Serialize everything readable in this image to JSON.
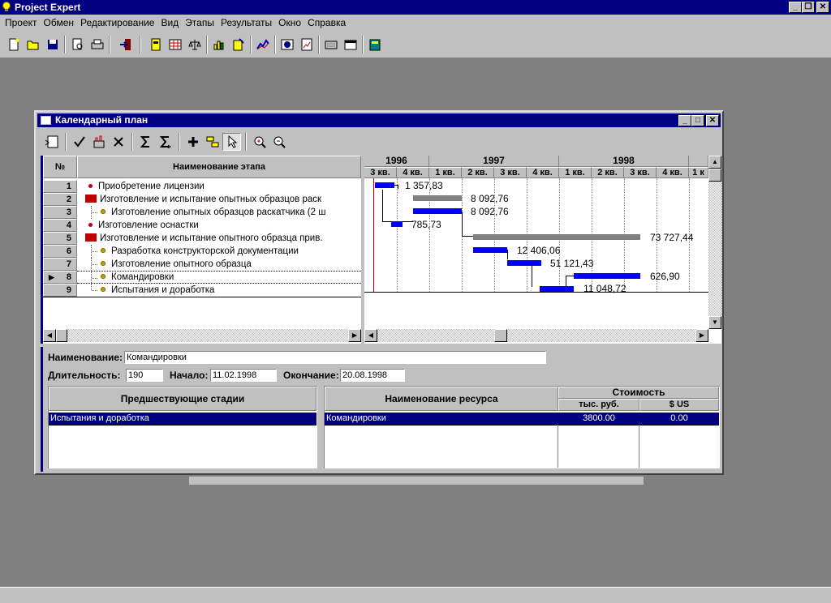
{
  "app": {
    "title": "Project Expert"
  },
  "menu": [
    "Проект",
    "Обмен",
    "Редактирование",
    "Вид",
    "Этапы",
    "Результаты",
    "Окно",
    "Справка"
  ],
  "window": {
    "title": "Календарный план"
  },
  "table": {
    "col_num": "№",
    "col_name": "Наименование этапа",
    "rows": [
      {
        "num": "1",
        "name": "Приобретение лицензии"
      },
      {
        "num": "2",
        "name": "Изготовление  и испытание опытных образцов раск"
      },
      {
        "num": "3",
        "name": "Изготовление опытных образцов раскатчика (2 ш"
      },
      {
        "num": "4",
        "name": "Изготовление оснастки"
      },
      {
        "num": "5",
        "name": "Изготовление и испытание опытного образца прив."
      },
      {
        "num": "6",
        "name": "Разработка конструкторской документации"
      },
      {
        "num": "7",
        "name": "Изготовление опытного образца"
      },
      {
        "num": "8",
        "name": "Командировки"
      },
      {
        "num": "9",
        "name": "Испытания и доработка"
      }
    ]
  },
  "gantt": {
    "years": [
      "1996",
      "1997",
      "1998"
    ],
    "quarters": [
      "3 кв.",
      "4 кв.",
      "1 кв.",
      "2 кв.",
      "3 кв.",
      "4 кв.",
      "1 кв.",
      "2 кв.",
      "3 кв.",
      "4 кв.",
      "1 к"
    ],
    "labels": [
      "1 357,83",
      "8 092,76",
      "8 092,76",
      "785,73",
      "73 727,44",
      "12 406,06",
      "51 121,43",
      "626,90",
      "11 048,72"
    ]
  },
  "form": {
    "name_label": "Наименование:",
    "name_value": "Командировки",
    "duration_label": "Длительность:",
    "duration_value": "190",
    "start_label": "Начало:",
    "start_value": "11.02.1998",
    "end_label": "Окончание:",
    "end_value": "20.08.1998",
    "pred_header": "Предшествующие стадии",
    "pred_rows": [
      "Испытания и доработка"
    ],
    "res_header": "Наименование ресурса",
    "cost_header": "Стоимость",
    "cost_rub_header": "тыс. руб.",
    "cost_usd_header": "$ US",
    "res_rows": [
      {
        "name": "Командировки",
        "rub": "3800.00",
        "usd": "0.00"
      }
    ]
  },
  "colors": {
    "titlebar": "#000080",
    "bar_blue": "#0000ff",
    "bar_gray": "#808080",
    "face": "#c0c0c0"
  }
}
